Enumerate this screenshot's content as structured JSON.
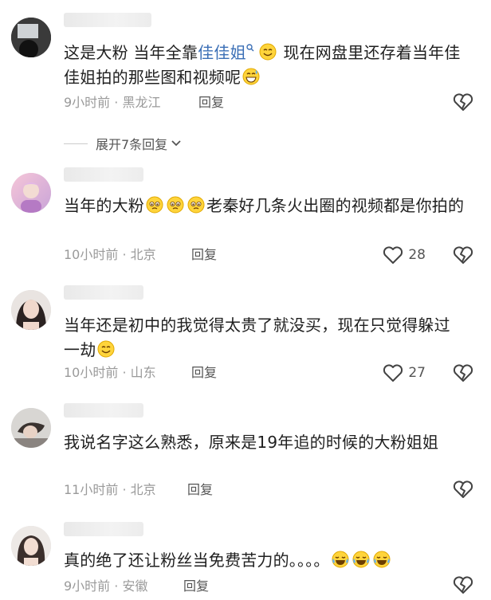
{
  "comments": [
    {
      "text_before": "这是大粉 当年全靠",
      "mention": "佳佳姐",
      "text_after_1": " 现在网盘里还存着当年佳佳姐拍的那些图和视频呢",
      "time": "9小时前",
      "location": "黑龙江",
      "reply_label": "回复"
    },
    {
      "text_before": "当年的大粉",
      "text_after": "老秦好几条火出圈的视频都是你拍的",
      "time": "10小时前",
      "location": "北京",
      "reply_label": "回复",
      "likes": "28"
    },
    {
      "text_before": "当年还是初中的我觉得太贵了就没买，现在只觉得躲过一劫",
      "time": "10小时前",
      "location": "山东",
      "reply_label": "回复",
      "likes": "27"
    },
    {
      "text_before": "我说名字这么熟悉，原来是19年追的时候的大粉姐姐",
      "time": "11小时前",
      "location": "北京",
      "reply_label": "回复"
    },
    {
      "text_before": "真的绝了还让粉丝当免费苦力的。。。。",
      "time": "9小时前",
      "location": "安徽",
      "reply_label": "回复"
    }
  ],
  "expand_label": "展开7条回复",
  "meta_separator": "·",
  "icons": {
    "dislike": "broken-heart-icon",
    "like": "heart-outline-icon",
    "expand": "chevron-down-icon",
    "mention_search": "search-icon"
  }
}
